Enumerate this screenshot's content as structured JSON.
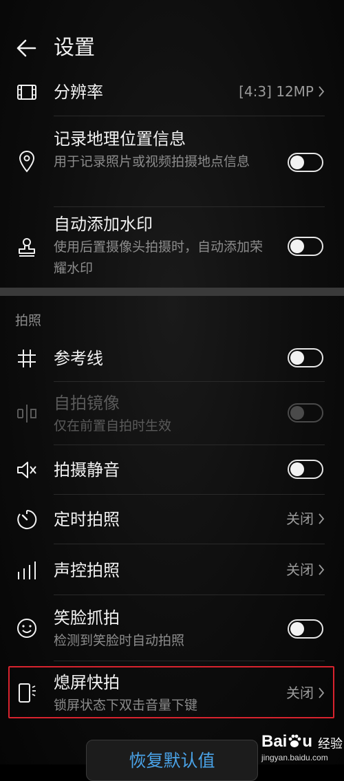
{
  "header": {
    "title": "设置"
  },
  "photo": {
    "resolution": {
      "title": "分辨率",
      "value": "[4:3] 12MP"
    },
    "location": {
      "title": "记录地理位置信息",
      "subtitle": "用于记录照片或视频拍摄地点信息",
      "enabled": false
    },
    "watermark": {
      "title": "自动添加水印",
      "subtitle": "使用后置摄像头拍摄时，自动添加荣耀水印",
      "enabled": false
    }
  },
  "capture_section": {
    "label": "拍照",
    "grid": {
      "title": "参考线",
      "enabled": false
    },
    "mirror": {
      "title": "自拍镜像",
      "subtitle": "仅在前置自拍时生效",
      "enabled": false,
      "disabled": true
    },
    "mute": {
      "title": "拍摄静音",
      "enabled": false
    },
    "timer": {
      "title": "定时拍照",
      "value": "关闭"
    },
    "voice": {
      "title": "声控拍照",
      "value": "关闭"
    },
    "smile": {
      "title": "笑脸抓拍",
      "subtitle": "检测到笑脸时自动拍照",
      "enabled": false
    },
    "snapshot": {
      "title": "熄屏快拍",
      "subtitle": "锁屏状态下双击音量下键",
      "value": "关闭"
    }
  },
  "footer": {
    "restore_label": "恢复默认值"
  },
  "overlay": {
    "logo_left": "Bai",
    "logo_right": "u",
    "logo_text": "经验",
    "url": "jingyan.baidu.com"
  },
  "colors": {
    "background": "#000000",
    "accent": "#4aa3e8",
    "highlight_border": "#d9232e"
  }
}
